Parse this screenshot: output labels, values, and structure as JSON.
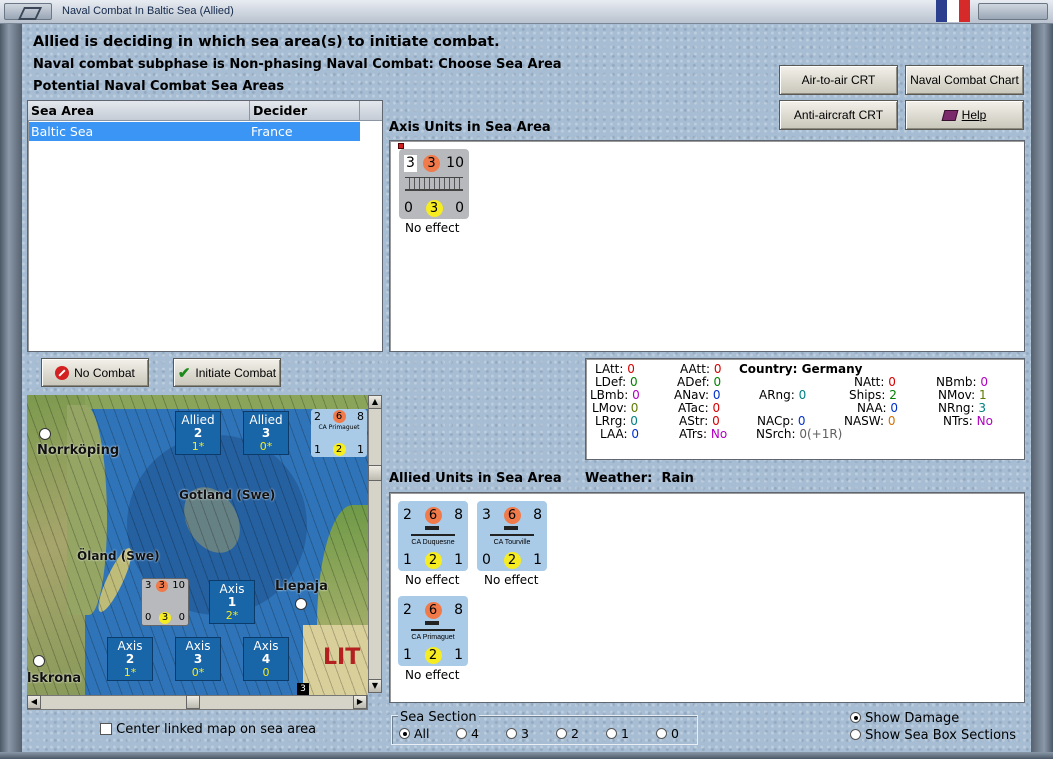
{
  "window": {
    "title": "Naval Combat In Baltic Sea (Allied)"
  },
  "header": {
    "line1": "Allied is deciding in which sea area(s) to initiate combat.",
    "line2": "Naval combat subphase is Non-phasing Naval Combat: Choose Sea Area",
    "line3": "Potential Naval Combat Sea Areas"
  },
  "buttons": {
    "air_to_air": "Air-to-air CRT",
    "naval_chart": "Naval Combat Chart",
    "anti_aircraft": "Anti-aircraft CRT",
    "help": "Help",
    "no_combat": "No Combat",
    "initiate": "Initiate Combat"
  },
  "sea_table": {
    "col_area": "Sea Area",
    "col_decider": "Decider",
    "rows": [
      {
        "area": "Baltic Sea",
        "decider": "France"
      }
    ]
  },
  "axis": {
    "label": "Axis Units in Sea Area",
    "units": [
      {
        "top": [
          "3",
          "3",
          "10"
        ],
        "bottom": [
          "0",
          "3",
          "0"
        ],
        "name": "",
        "effect": "No effect"
      }
    ]
  },
  "allied": {
    "label": "Allied Units in Sea Area",
    "weather_label": "Weather:",
    "weather": "Rain",
    "units": [
      {
        "top": [
          "2",
          "6",
          "8"
        ],
        "bottom": [
          "1",
          "2",
          "1"
        ],
        "name": "CA Duquesne",
        "effect": "No effect"
      },
      {
        "top": [
          "3",
          "6",
          "8"
        ],
        "bottom": [
          "0",
          "2",
          "1"
        ],
        "name": "CA Tourville",
        "effect": "No effect"
      },
      {
        "top": [
          "2",
          "6",
          "8"
        ],
        "bottom": [
          "1",
          "2",
          "1"
        ],
        "name": "CA Primaguet",
        "effect": "No effect"
      }
    ]
  },
  "stats": {
    "country_label": "Country:",
    "country": "Germany",
    "LAtt": "0",
    "LDef": "0",
    "LBmb": "0",
    "LMov": "0",
    "LRrg": "0",
    "LAA": "0",
    "AAtt": "0",
    "ADef": "0",
    "ANav": "0",
    "ATac": "0",
    "AStr": "0",
    "ATrs": "No",
    "ARng": "0",
    "NACp": "0",
    "NSrch": "0(+1R)",
    "NAtt": "0",
    "Ships": "2",
    "NAA": "0",
    "NASW": "0",
    "NBmb": "0",
    "NMov": "1",
    "NRng": "3",
    "NTrs": "No"
  },
  "map": {
    "labels": {
      "norrkoping": "Norrköping",
      "gotland": "Gotland (Swe)",
      "oland": "Öland (Swe)",
      "liepaja": "Liepaja",
      "karlskrona": "lskrona",
      "lit": "LIT"
    },
    "boxes": [
      {
        "side": "Allied",
        "num": "2",
        "sub": "1*"
      },
      {
        "side": "Allied",
        "num": "3",
        "sub": "0*"
      },
      {
        "side": "Axis",
        "num": "1",
        "sub": "2*"
      },
      {
        "side": "Axis",
        "num": "2",
        "sub": "1*"
      },
      {
        "side": "Axis",
        "num": "3",
        "sub": "0*"
      },
      {
        "side": "Axis",
        "num": "4",
        "sub": "0"
      }
    ],
    "mini_allied": {
      "top": [
        "2",
        "6",
        "8"
      ],
      "bottom": [
        "1",
        "2",
        "1"
      ],
      "name": "CA Primaguet"
    },
    "mini_axis": {
      "top": [
        "3",
        "3",
        "10"
      ],
      "bottom": [
        "0",
        "3",
        "0"
      ]
    },
    "corner_num": "3",
    "center_label": "Center linked map on sea area"
  },
  "sea_section": {
    "legend": "Sea Section",
    "options": [
      "All",
      "4",
      "3",
      "2",
      "1",
      "0"
    ],
    "selected": "All"
  },
  "display": {
    "show_damage": "Show Damage",
    "show_boxes": "Show Sea Box Sections",
    "selected": "Show Damage"
  }
}
